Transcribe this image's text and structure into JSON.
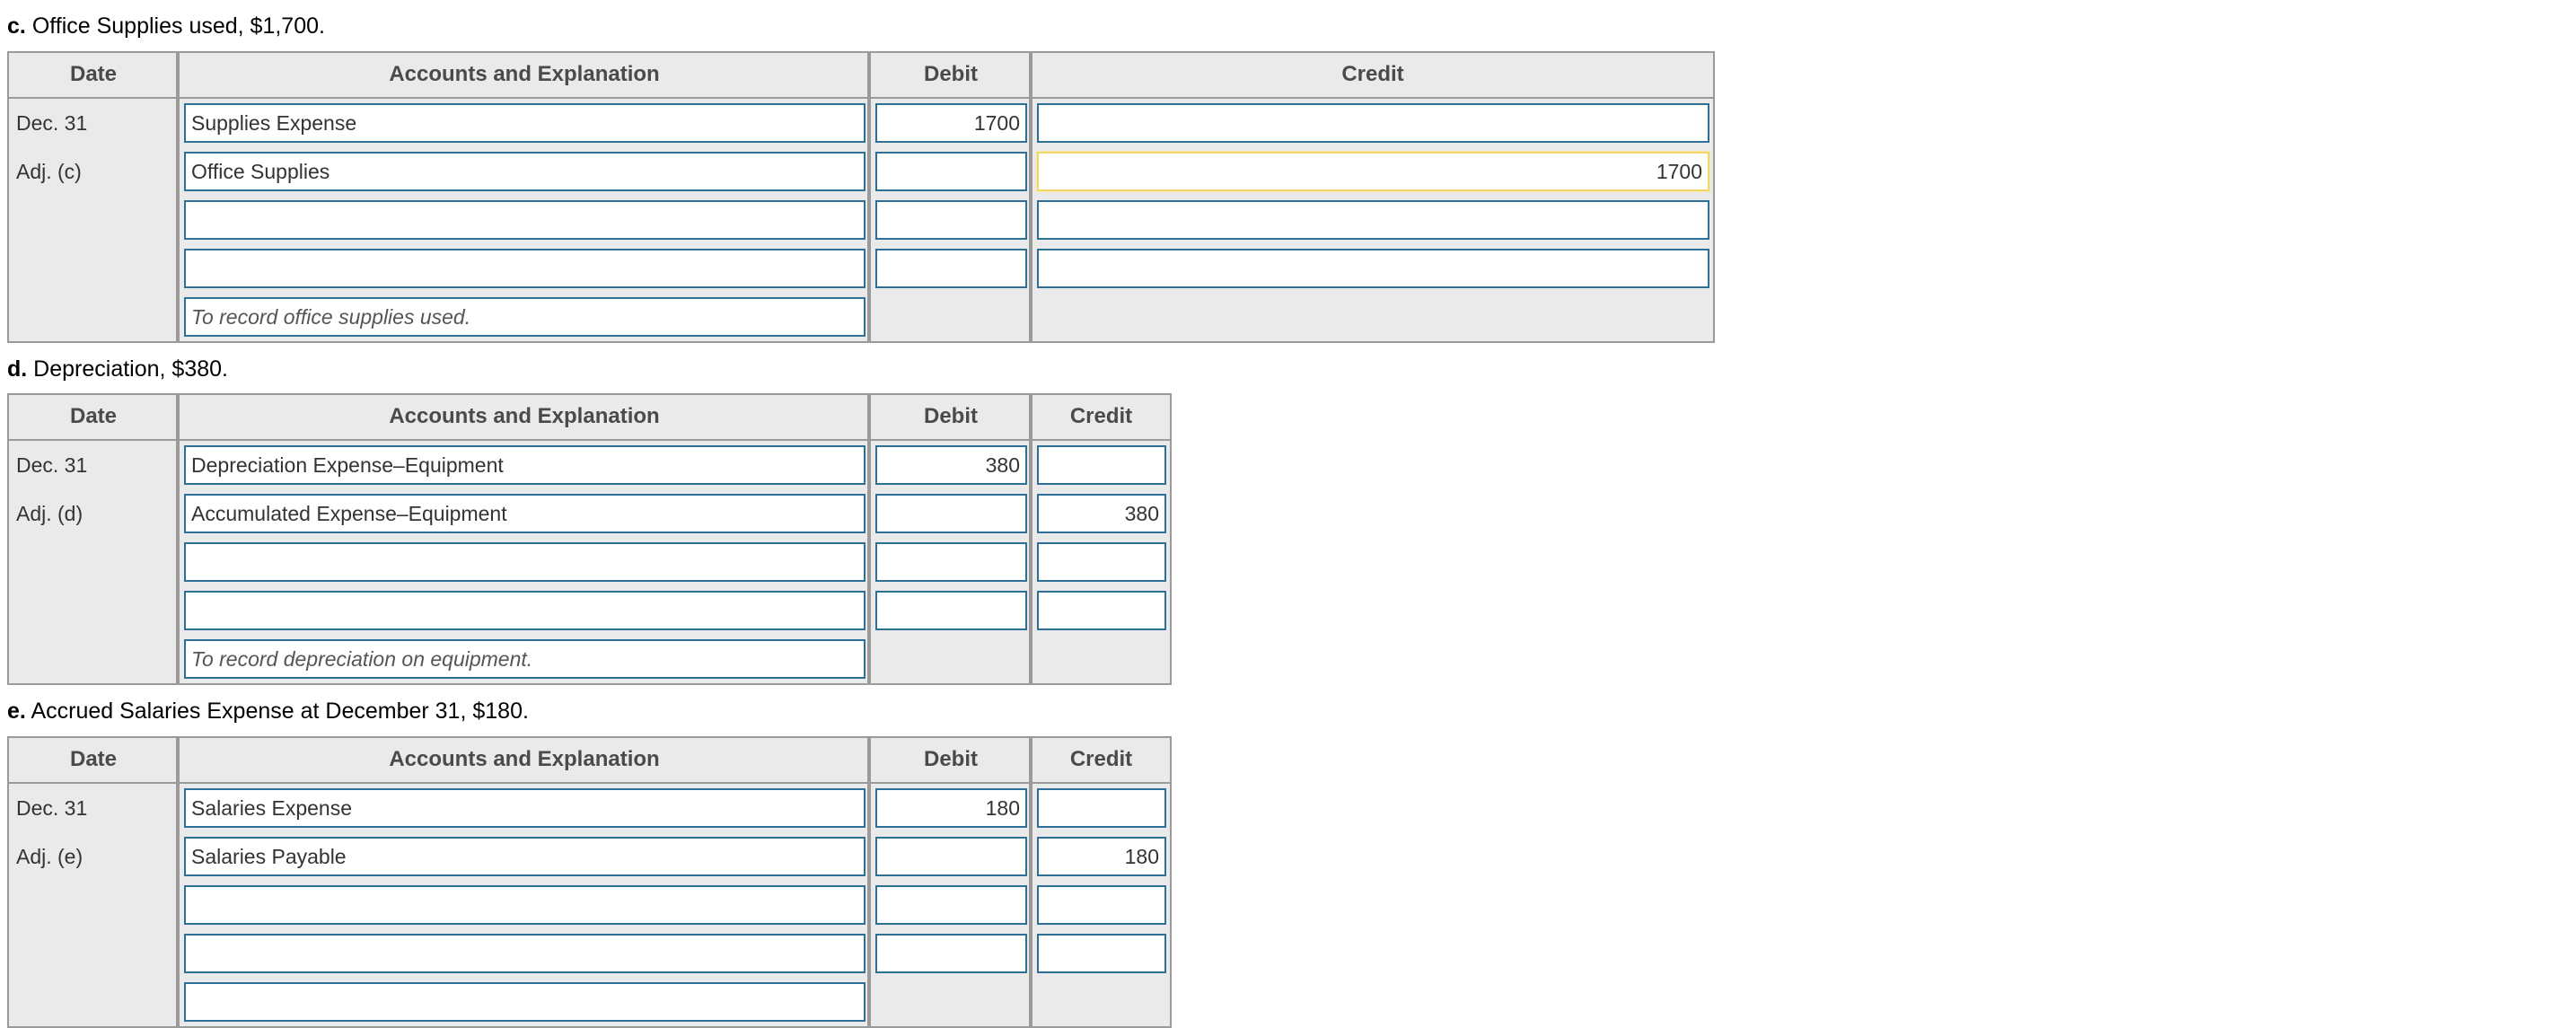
{
  "colors": {
    "field_border": "#2e6f96",
    "field_border_active": "#f2d66b",
    "table_border": "#9a9a9a",
    "header_bg": "#eaeaea",
    "header_text": "#4a4a4a"
  },
  "columns": {
    "date": "Date",
    "accounts": "Accounts and Explanation",
    "debit": "Debit",
    "credit": "Credit"
  },
  "sections": [
    {
      "id": "c",
      "letter": "c.",
      "prompt": "Office Supplies used, $1,700.",
      "dates": [
        "Dec. 31",
        "Adj. (c)",
        "",
        "",
        ""
      ],
      "rows": [
        {
          "account": "Supplies Expense",
          "debit": "1700",
          "credit": "",
          "memo": false,
          "active": ""
        },
        {
          "account": "Office Supplies",
          "debit": "",
          "credit": "1700",
          "memo": false,
          "active": "credit"
        },
        {
          "account": "",
          "debit": "",
          "credit": "",
          "memo": false,
          "active": ""
        },
        {
          "account": "",
          "debit": "",
          "credit": "",
          "memo": false,
          "active": ""
        },
        {
          "account": "To record office supplies used.",
          "debit": null,
          "credit": null,
          "memo": true,
          "active": ""
        }
      ]
    },
    {
      "id": "d",
      "letter": "d.",
      "prompt": "Depreciation, $380.",
      "dates": [
        "Dec. 31",
        "Adj. (d)",
        "",
        "",
        ""
      ],
      "rows": [
        {
          "account": "Depreciation Expense–Equipment",
          "debit": "380",
          "credit": "",
          "memo": false,
          "active": ""
        },
        {
          "account": "Accumulated Expense–Equipment",
          "debit": "",
          "credit": "380",
          "memo": false,
          "active": ""
        },
        {
          "account": "",
          "debit": "",
          "credit": "",
          "memo": false,
          "active": ""
        },
        {
          "account": "",
          "debit": "",
          "credit": "",
          "memo": false,
          "active": ""
        },
        {
          "account": "To record depreciation on equipment.",
          "debit": null,
          "credit": null,
          "memo": true,
          "active": ""
        }
      ]
    },
    {
      "id": "e",
      "letter": "e.",
      "prompt": "Accrued Salaries Expense at December 31, $180.",
      "dates": [
        "Dec. 31",
        "Adj. (e)",
        "",
        "",
        ""
      ],
      "rows": [
        {
          "account": "Salaries Expense",
          "debit": "180",
          "credit": "",
          "memo": false,
          "active": ""
        },
        {
          "account": "Salaries Payable",
          "debit": "",
          "credit": "180",
          "memo": false,
          "active": ""
        },
        {
          "account": "",
          "debit": "",
          "credit": "",
          "memo": false,
          "active": ""
        },
        {
          "account": "",
          "debit": "",
          "credit": "",
          "memo": false,
          "active": ""
        },
        {
          "account": "",
          "debit": null,
          "credit": null,
          "memo": true,
          "active": ""
        }
      ]
    }
  ]
}
